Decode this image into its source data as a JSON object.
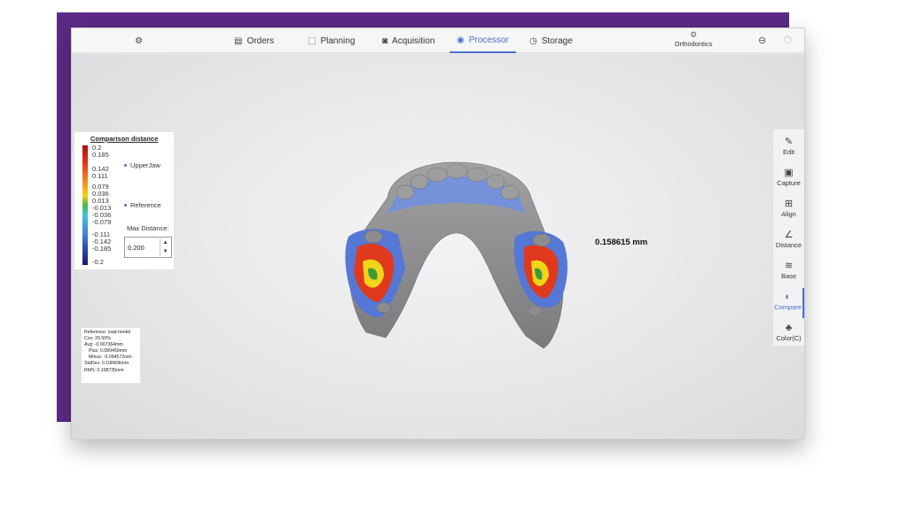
{
  "topbar": {
    "settings_icon": "gear-icon",
    "tabs": [
      {
        "label": "Orders",
        "icon": "orders-icon"
      },
      {
        "label": "Planning",
        "icon": "planning-icon"
      },
      {
        "label": "Acquisition",
        "icon": "acquisition-icon"
      },
      {
        "label": "Processor",
        "icon": "processor-icon",
        "active": true
      },
      {
        "label": "Storage",
        "icon": "storage-icon"
      }
    ],
    "workflow": {
      "label": "Orthodontics",
      "icon": "gear-icon"
    },
    "minimize_icon": "minimize-icon",
    "power_icon": "power-icon"
  },
  "legend": {
    "title": "Comparison distance",
    "ticks": [
      "0.2",
      "0.185",
      "0.142",
      "0.111",
      "0.079",
      "0.036",
      "0.013",
      "-0.013",
      "-0.036",
      "-0.079",
      "-0.111",
      "-0.142",
      "-0.185",
      "-0.2"
    ],
    "series": [
      {
        "label": "UpperJaw",
        "color": "#4a6fc8"
      },
      {
        "label": "Reference",
        "color": "#4a6fc8"
      }
    ],
    "max_distance_label": "Max Distance:",
    "max_distance_value": "0.200"
  },
  "stats": {
    "lines": [
      "Reference: load model",
      "Cov: 29.50%",
      "Avg: -0.007364mm",
      "  Plus: 0.089469mm",
      "  Minus: -0.094572mm",
      "StdDev: 0.108406mm",
      "RMS: 0.108735mm"
    ]
  },
  "annotation": {
    "text": "0.158615 mm"
  },
  "rightbar": {
    "items": [
      {
        "label": "Edit",
        "icon": "edit-icon"
      },
      {
        "label": "Capture",
        "icon": "capture-icon"
      },
      {
        "label": "Align",
        "icon": "align-icon"
      },
      {
        "label": "Distance",
        "icon": "distance-icon"
      },
      {
        "label": "Base",
        "icon": "base-icon"
      },
      {
        "label": "Compare",
        "icon": "compare-icon",
        "active": true
      },
      {
        "label": "Color(C)",
        "icon": "color-icon"
      }
    ]
  },
  "colors": {
    "accent": "#4a6fc8",
    "frame": "#5b2a86",
    "model_gray": "#8a8a8c",
    "deviation_blue": "#5577d6",
    "deviation_red": "#d42a1c",
    "deviation_yellow": "#f2d419"
  }
}
